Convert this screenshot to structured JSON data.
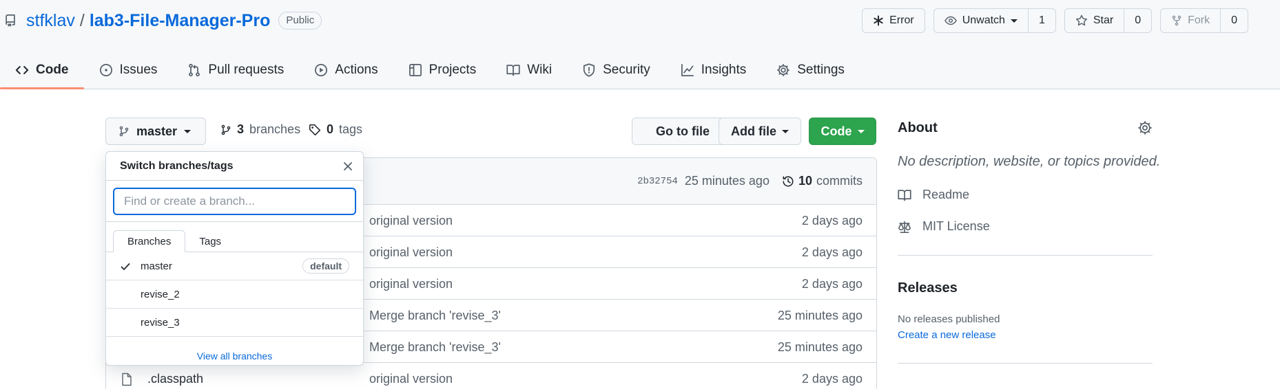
{
  "repo": {
    "owner": "stfklav",
    "name": "lab3-File-Manager-Pro",
    "visibility": "Public",
    "actions": {
      "error_label": "Error",
      "unwatch_label": "Unwatch",
      "watch_count": "1",
      "star_label": "Star",
      "star_count": "0",
      "fork_label": "Fork",
      "fork_count": "0"
    }
  },
  "tabs": [
    {
      "label": "Code",
      "icon": "code-icon",
      "selected": true
    },
    {
      "label": "Issues",
      "icon": "issue-icon"
    },
    {
      "label": "Pull requests",
      "icon": "pull-request-icon"
    },
    {
      "label": "Actions",
      "icon": "play-icon"
    },
    {
      "label": "Projects",
      "icon": "table-icon"
    },
    {
      "label": "Wiki",
      "icon": "book-icon"
    },
    {
      "label": "Security",
      "icon": "shield-icon"
    },
    {
      "label": "Insights",
      "icon": "graph-icon"
    },
    {
      "label": "Settings",
      "icon": "gear-icon"
    }
  ],
  "toolbar": {
    "branch": "master",
    "branches_count": "3",
    "branches_label": "branches",
    "tags_count": "0",
    "tags_label": "tags",
    "go_to_file": "Go to file",
    "add_file": "Add file",
    "code": "Code"
  },
  "commit": {
    "sha": "2b32754",
    "time": "25 minutes ago",
    "commits_count": "10",
    "commits_label": "commits"
  },
  "files": [
    {
      "name": "",
      "message": "original version",
      "age": "2 days ago"
    },
    {
      "name": "",
      "message": "original version",
      "age": "2 days ago"
    },
    {
      "name": "",
      "message": "original version",
      "age": "2 days ago"
    },
    {
      "name": "",
      "message": "Merge branch 'revise_3'",
      "age": "25 minutes ago"
    },
    {
      "name": "",
      "message": "Merge branch 'revise_3'",
      "age": "25 minutes ago"
    },
    {
      "name": ".classpath",
      "message": "original version",
      "age": "2 days ago"
    }
  ],
  "branch_popover": {
    "title": "Switch branches/tags",
    "filter_placeholder": "Find or create a branch...",
    "tabs": [
      "Branches",
      "Tags"
    ],
    "branches": [
      {
        "name": "master",
        "selected": true,
        "badge": "default"
      },
      {
        "name": "revise_2"
      },
      {
        "name": "revise_3"
      }
    ],
    "view_all": "View all branches"
  },
  "about": {
    "title": "About",
    "description": "No description, website, or topics provided.",
    "readme": "Readme",
    "license": "MIT License"
  },
  "releases": {
    "title": "Releases",
    "none": "No releases published",
    "create": "Create a new release"
  },
  "colors": {
    "link": "#0969da",
    "primary_button": "#2da44e",
    "tab_underline": "#fd8c73",
    "header_bg": "#f6f8fa"
  }
}
